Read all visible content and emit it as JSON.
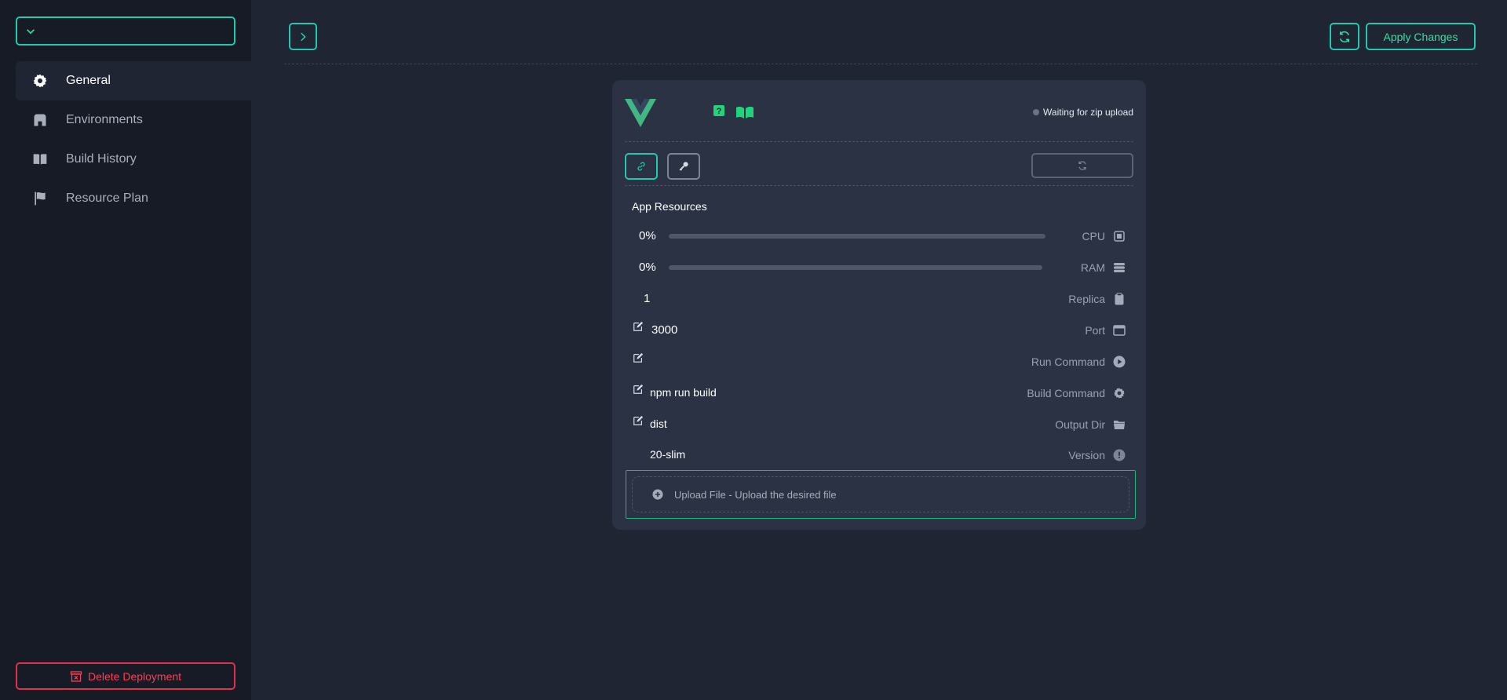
{
  "sidebar": {
    "project_select_value": "",
    "items": [
      {
        "label": "General",
        "icon": "gear-icon",
        "active": true
      },
      {
        "label": "Environments",
        "icon": "building-icon",
        "active": false
      },
      {
        "label": "Build History",
        "icon": "book-icon",
        "active": false
      },
      {
        "label": "Resource Plan",
        "icon": "flag-icon",
        "active": false
      }
    ],
    "delete_label": "Delete Deployment"
  },
  "header": {
    "apply_label": "Apply Changes"
  },
  "card": {
    "status_text": "Waiting for zip upload",
    "section_title": "App Resources",
    "cpu": {
      "value": "0%",
      "label": "CPU",
      "progress": 0
    },
    "ram": {
      "value": "0%",
      "label": "RAM",
      "progress": 0
    },
    "replica": {
      "value": "1",
      "label": "Replica"
    },
    "port": {
      "value": "3000",
      "label": "Port"
    },
    "run_command": {
      "value": "",
      "label": "Run Command"
    },
    "build_command": {
      "value": "npm run build",
      "label": "Build Command"
    },
    "output_dir": {
      "value": "dist",
      "label": "Output Dir"
    },
    "version": {
      "value": "20-slim",
      "label": "Version"
    },
    "upload_text": "Upload File - Upload the desired file"
  },
  "colors": {
    "accent": "#22c9b0",
    "accent_text": "#2fe0a0",
    "danger": "#ff3b57",
    "sidebar_bg": "#171b26",
    "main_bg": "#1f2533",
    "card_bg": "#2a3243"
  }
}
